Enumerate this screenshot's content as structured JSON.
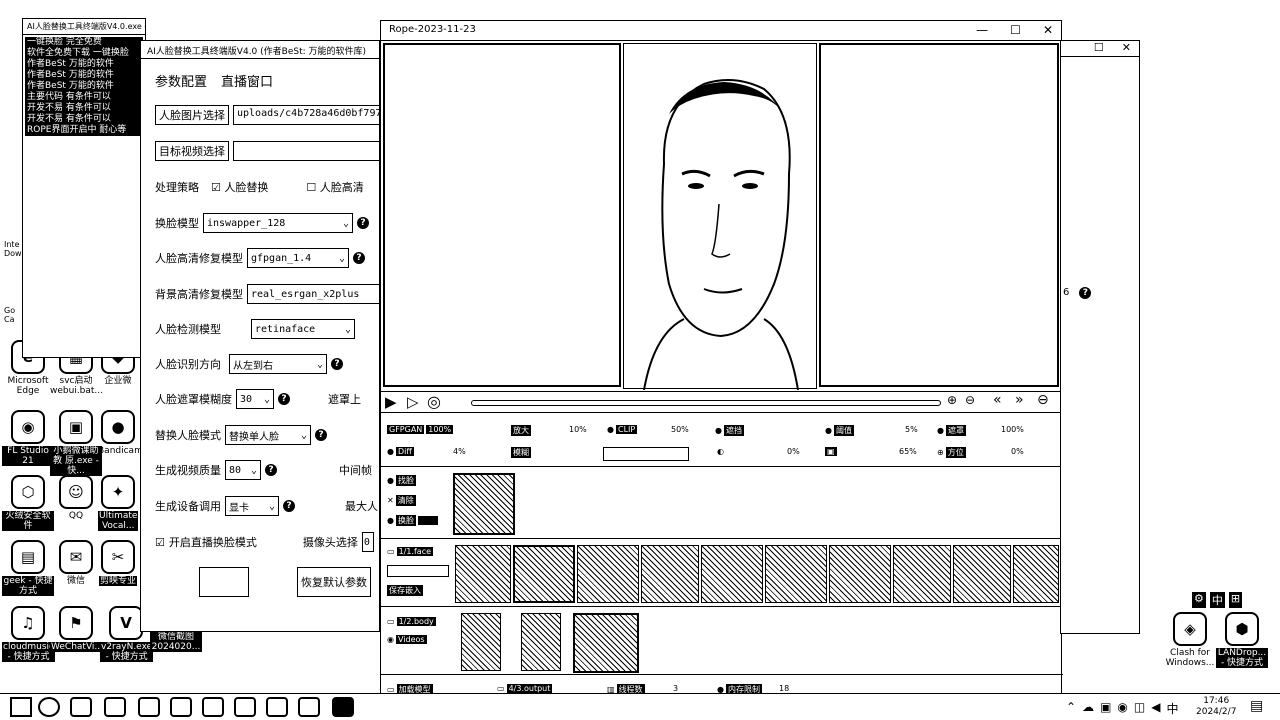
{
  "desktop": {
    "icons": [
      {
        "label": "Microsoft Edge",
        "glyph": "e"
      },
      {
        "label": "svc启动 webui.bat...",
        "glyph": "▦"
      },
      {
        "label": "企业微",
        "glyph": "◆"
      },
      {
        "label": "FL Studio 21",
        "glyph": "◉"
      },
      {
        "label": "小鹅微课助教 原.exe - 快...",
        "glyph": "▣"
      },
      {
        "label": "Bandicam",
        "glyph": "●"
      },
      {
        "label": "火绒安全软件",
        "glyph": "⬡"
      },
      {
        "label": "QQ",
        "glyph": "☺"
      },
      {
        "label": "Ultimate Vocal...",
        "glyph": "✦"
      },
      {
        "label": "geek - 快捷方式",
        "glyph": "▤"
      },
      {
        "label": "微信",
        "glyph": "✉"
      },
      {
        "label": "剪映专业",
        "glyph": "✂"
      },
      {
        "label": "cloudmusic - 快捷方式",
        "glyph": "♫"
      },
      {
        "label": "WeChatVi...",
        "glyph": "⚑"
      },
      {
        "label": "v2rayN.exe - 快捷方式",
        "glyph": "V"
      },
      {
        "label": "微信截图 2024020...",
        "glyph": "▧"
      },
      {
        "label": "Clash for Windows...",
        "glyph": "◈"
      },
      {
        "label": "LANDrop... - 快捷方式",
        "glyph": "⬢"
      }
    ],
    "left_snippets": [
      "Inte Dow",
      "Go Ca"
    ],
    "shortcut_title": "AI人脸替换工具终端版V4.0.exe - 快捷方式",
    "side_text": [
      "一键换脸 完全免费",
      "软件全免费下载 一键换脸",
      "作者BeSt 万能的软件",
      "作者BeSt 万能的软件",
      "作者BeSt 万能的软件",
      "主要代码 有条件可以",
      "开发不易 有条件可以",
      "开发不易 有条件可以",
      "ROPE界面开启中 耐心等"
    ]
  },
  "left_app": {
    "title": "AI人脸替换工具终端版V4.0 (作者BeSt: 万能的软件库)",
    "tabs": [
      "参数配置",
      "直播窗口"
    ],
    "face_image_button": "人脸图片选择",
    "face_image_path": "uploads/c4b728a46d0bf797b3",
    "target_video_button": "目标视频选择",
    "target_video_path": "",
    "strategy_label": "处理策略",
    "strategy_opt1": "人脸替换",
    "strategy_opt2": "人脸高清",
    "swap_model_label": "换脸模型",
    "swap_model_value": "inswapper_128",
    "face_hd_label": "人脸高清修复模型",
    "face_hd_value": "gfpgan_1.4",
    "bg_hd_label": "背景高清修复模型",
    "bg_hd_value": "real_esrgan_x2plus",
    "detect_model_label": "人脸检测模型",
    "detect_model_value": "retinaface",
    "direction_label": "人脸识别方向",
    "direction_value": "从左到右",
    "mask_blur_label": "人脸遮罩模糊度",
    "mask_blur_value": "30",
    "mask_right_label": "遮罩上",
    "replace_mode_label": "替换人脸模式",
    "replace_mode_value": "替换单人脸",
    "quality_label": "生成视频质量",
    "quality_value": "80",
    "quality_right_label": "中间帧",
    "device_label": "生成设备调用",
    "device_value": "显卡",
    "device_right_label": "最大人",
    "live_label": "开启直播换脸模式",
    "camera_label": "摄像头选择",
    "camera_value": "0",
    "start_button": "",
    "reset_button": "恢复默认参数"
  },
  "rope": {
    "title": "Rope-2023-11-23",
    "controls": {
      "gfpgan": "GFPGAN",
      "gfpgan_val": "100%",
      "upscale": "放大",
      "upscale_val": "10%",
      "clip": "CLIP",
      "clip_val": "50%",
      "occluder": "遮挡",
      "threshold": "阈值",
      "threshold_val": "5%",
      "mask": "遮罩",
      "mask_val": "100%",
      "diff": "Diff",
      "diff_val": "4%",
      "blur": "模糊",
      "row2_val1": "0%",
      "row2_val2": "65%",
      "direction": "方位",
      "direction_val": "0%"
    },
    "found_faces": [
      "找脸",
      "清除",
      "换脸"
    ],
    "faces_folder": "1/1.face",
    "faces_action": "保存嵌入",
    "videos_folder": "1/2.body",
    "videos_label": "Videos",
    "bottom_bar": [
      "加载模型",
      "4/3.output",
      "线程数",
      "3",
      "内存限制",
      "18"
    ],
    "right_number": "6"
  },
  "taskbar": {
    "time": "17:46",
    "date": "2024/2/7",
    "ime": "中"
  }
}
